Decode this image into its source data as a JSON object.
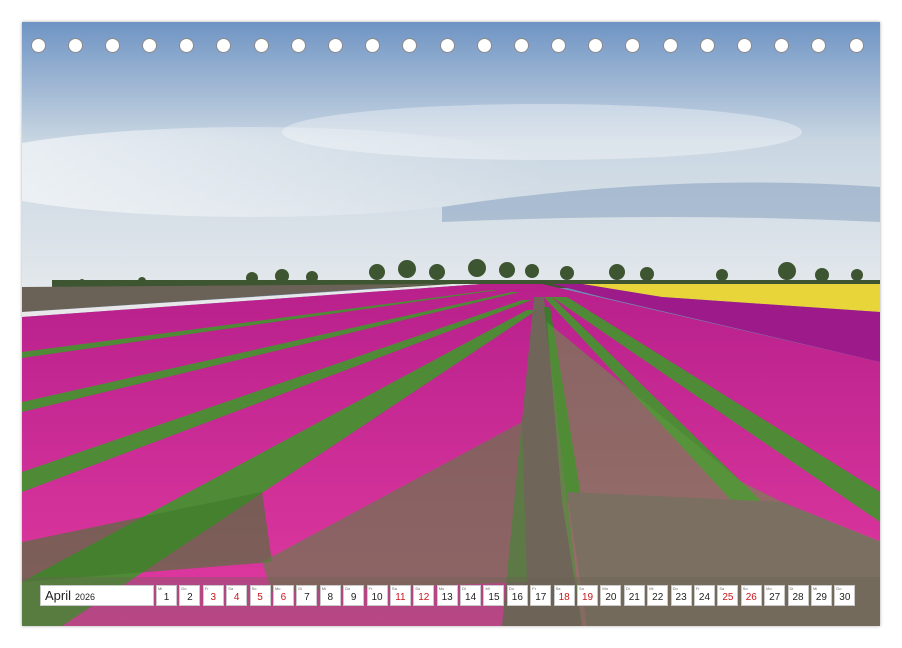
{
  "calendar": {
    "month": "April",
    "year": "2026",
    "hole_count": 23,
    "red_color": "#c8161d",
    "days": [
      {
        "wd": "Mi",
        "n": "1",
        "red": false
      },
      {
        "wd": "Do",
        "n": "2",
        "red": false
      },
      {
        "wd": "Fr",
        "n": "3",
        "red": true
      },
      {
        "wd": "Sa",
        "n": "4",
        "red": true
      },
      {
        "wd": "So",
        "n": "5",
        "red": true
      },
      {
        "wd": "Mo",
        "n": "6",
        "red": true
      },
      {
        "wd": "Di",
        "n": "7",
        "red": false
      },
      {
        "wd": "Mi",
        "n": "8",
        "red": false
      },
      {
        "wd": "Do",
        "n": "9",
        "red": false
      },
      {
        "wd": "Fr",
        "n": "10",
        "red": false
      },
      {
        "wd": "Sa",
        "n": "11",
        "red": true
      },
      {
        "wd": "So",
        "n": "12",
        "red": true
      },
      {
        "wd": "Mo",
        "n": "13",
        "red": false
      },
      {
        "wd": "Di",
        "n": "14",
        "red": false
      },
      {
        "wd": "Mi",
        "n": "15",
        "red": false
      },
      {
        "wd": "Do",
        "n": "16",
        "red": false
      },
      {
        "wd": "Fr",
        "n": "17",
        "red": false
      },
      {
        "wd": "Sa",
        "n": "18",
        "red": true
      },
      {
        "wd": "So",
        "n": "19",
        "red": true
      },
      {
        "wd": "Mo",
        "n": "20",
        "red": false
      },
      {
        "wd": "Di",
        "n": "21",
        "red": false
      },
      {
        "wd": "Mi",
        "n": "22",
        "red": false
      },
      {
        "wd": "Do",
        "n": "23",
        "red": false
      },
      {
        "wd": "Fr",
        "n": "24",
        "red": false
      },
      {
        "wd": "Sa",
        "n": "25",
        "red": true
      },
      {
        "wd": "So",
        "n": "26",
        "red": true
      },
      {
        "wd": "Mo",
        "n": "27",
        "red": false
      },
      {
        "wd": "Di",
        "n": "28",
        "red": false
      },
      {
        "wd": "Mi",
        "n": "29",
        "red": false
      },
      {
        "wd": "Do",
        "n": "30",
        "red": false
      }
    ]
  },
  "photo": {
    "sky_top": "#6f94c4",
    "sky_bottom": "#dfe6ec",
    "tulip_pink": "#d8329a",
    "tulip_magenta": "#9c1a8a",
    "tulip_yellow": "#e8d53a",
    "leaf_green": "#4f8a36",
    "soil": "#6f6559"
  }
}
